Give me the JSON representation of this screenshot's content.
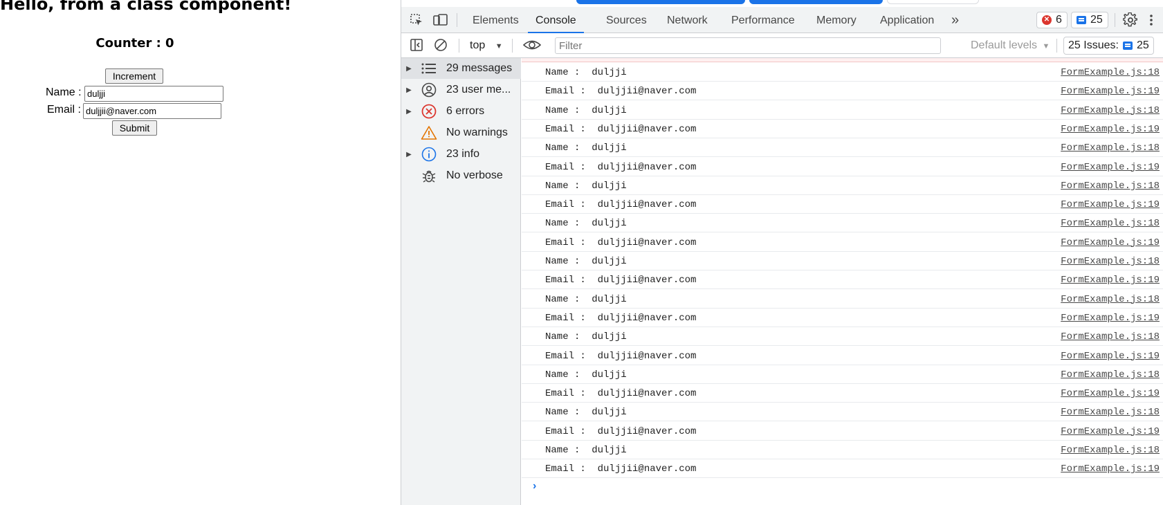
{
  "app": {
    "title": "Hello, from a class component!",
    "counter_label": "Counter : 0",
    "increment_label": "Increment",
    "name_label": "Name :",
    "name_value": "duljji",
    "email_label": "Email :",
    "email_value": "duljjii@naver.com",
    "submit_label": "Submit"
  },
  "devtools": {
    "tabs": [
      "Elements",
      "Console",
      "Sources",
      "Network",
      "Performance",
      "Memory",
      "Application"
    ],
    "active_tab": "Console",
    "more_tabs": "»",
    "error_count": "6",
    "message_count": "25",
    "toolbar": {
      "context": "top",
      "filter_placeholder": "Filter",
      "levels": "Default levels",
      "issues_label": "25 Issues:",
      "issues_count": "25"
    },
    "sidebar": [
      {
        "label": "29 messages",
        "icon": "list-icon",
        "expandable": true,
        "selected": true
      },
      {
        "label": "23 user me...",
        "icon": "user-icon",
        "expandable": true,
        "selected": false
      },
      {
        "label": "6 errors",
        "icon": "error-icon",
        "expandable": true,
        "selected": false
      },
      {
        "label": "No warnings",
        "icon": "warning-icon",
        "expandable": false,
        "selected": false
      },
      {
        "label": "23 info",
        "icon": "info-icon",
        "expandable": true,
        "selected": false
      },
      {
        "label": "No verbose",
        "icon": "bug-icon",
        "expandable": false,
        "selected": false
      }
    ],
    "logs": [
      {
        "msg": "Name :  duljji",
        "src": "FormExample.js:18"
      },
      {
        "msg": "Email :  duljjii@naver.com",
        "src": "FormExample.js:19"
      },
      {
        "msg": "Name :  duljji",
        "src": "FormExample.js:18"
      },
      {
        "msg": "Email :  duljjii@naver.com",
        "src": "FormExample.js:19"
      },
      {
        "msg": "Name :  duljji",
        "src": "FormExample.js:18"
      },
      {
        "msg": "Email :  duljjii@naver.com",
        "src": "FormExample.js:19"
      },
      {
        "msg": "Name :  duljji",
        "src": "FormExample.js:18"
      },
      {
        "msg": "Email :  duljjii@naver.com",
        "src": "FormExample.js:19"
      },
      {
        "msg": "Name :  duljji",
        "src": "FormExample.js:18"
      },
      {
        "msg": "Email :  duljjii@naver.com",
        "src": "FormExample.js:19"
      },
      {
        "msg": "Name :  duljji",
        "src": "FormExample.js:18"
      },
      {
        "msg": "Email :  duljjii@naver.com",
        "src": "FormExample.js:19"
      },
      {
        "msg": "Name :  duljji",
        "src": "FormExample.js:18"
      },
      {
        "msg": "Email :  duljjii@naver.com",
        "src": "FormExample.js:19"
      },
      {
        "msg": "Name :  duljji",
        "src": "FormExample.js:18"
      },
      {
        "msg": "Email :  duljjii@naver.com",
        "src": "FormExample.js:19"
      },
      {
        "msg": "Name :  duljji",
        "src": "FormExample.js:18"
      },
      {
        "msg": "Email :  duljjii@naver.com",
        "src": "FormExample.js:19"
      },
      {
        "msg": "Name :  duljji",
        "src": "FormExample.js:18"
      },
      {
        "msg": "Email :  duljjii@naver.com",
        "src": "FormExample.js:19"
      },
      {
        "msg": "Name :  duljji",
        "src": "FormExample.js:18"
      },
      {
        "msg": "Email :  duljjii@naver.com",
        "src": "FormExample.js:19"
      }
    ],
    "prompt": "›"
  },
  "colors": {
    "accent": "#1a73e8",
    "error": "#dc362e",
    "warning": "#e37400",
    "panel_bg": "#f1f3f4"
  }
}
